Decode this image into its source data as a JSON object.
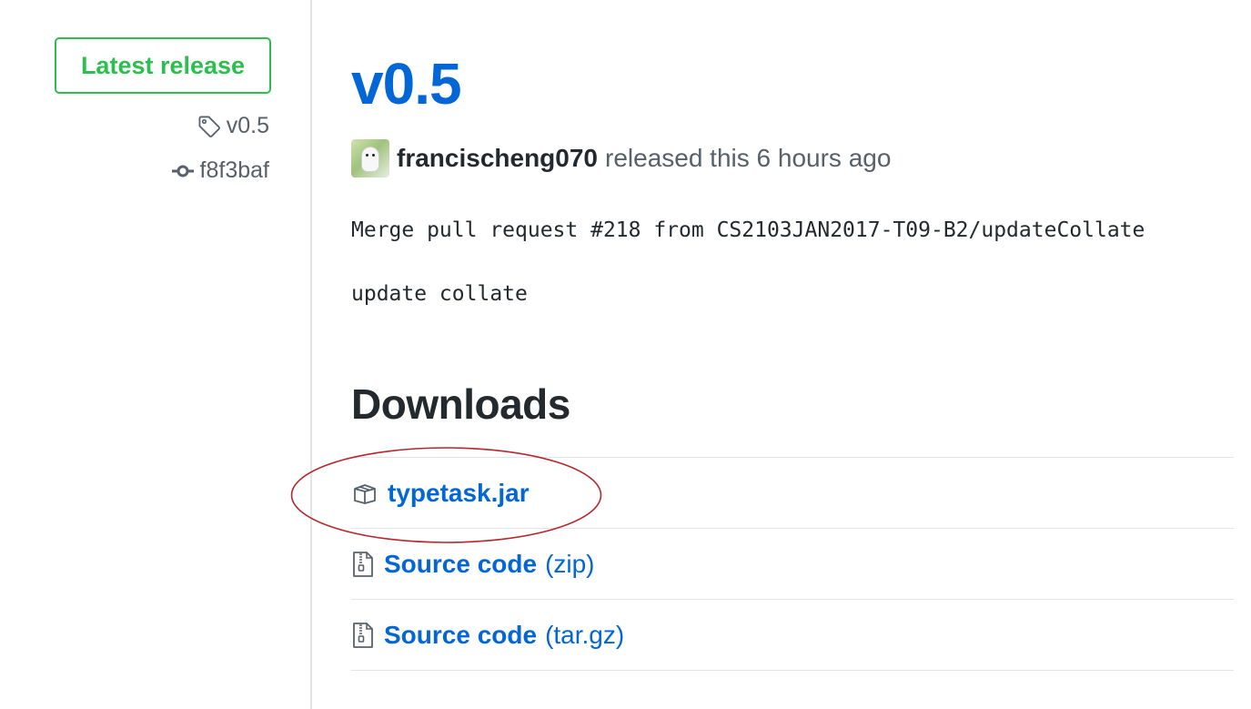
{
  "sidebar": {
    "latest_badge": "Latest release",
    "tag": "v0.5",
    "commit": "f8f3baf"
  },
  "release": {
    "title": "v0.5",
    "author": "francischeng070",
    "released_text": "released this 6 hours ago",
    "body_line1": "Merge pull request #218 from CS2103JAN2017-T09-B2/updateCollate",
    "body_line2": "update collate"
  },
  "downloads": {
    "heading": "Downloads",
    "items": [
      {
        "label": "typetask.jar",
        "suffix": "",
        "icon": "package-icon"
      },
      {
        "label": "Source code",
        "suffix": "(zip)",
        "icon": "file-zip-icon"
      },
      {
        "label": "Source code",
        "suffix": "(tar.gz)",
        "icon": "file-zip-icon"
      }
    ]
  },
  "colors": {
    "link": "#0366d6",
    "latest_green": "#2cbe4e",
    "annotation_red": "#b5272d"
  }
}
